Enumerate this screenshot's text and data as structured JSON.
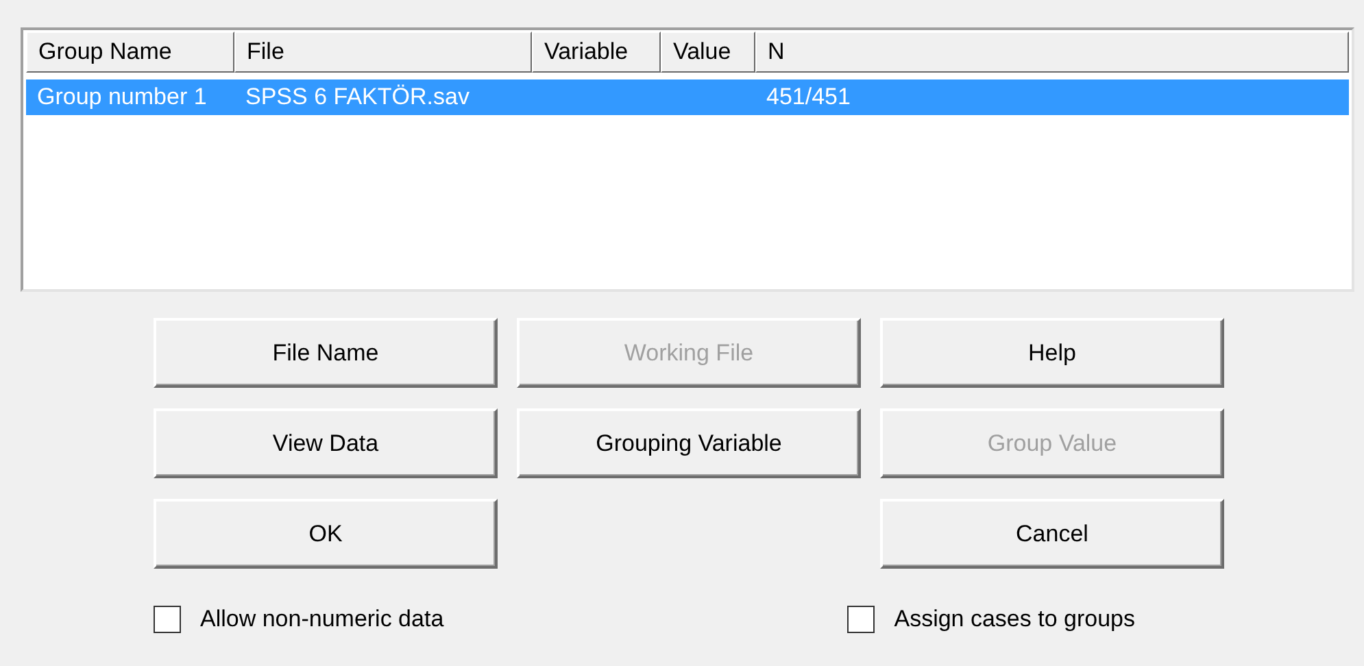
{
  "table": {
    "columns": [
      "Group Name",
      "File",
      "Variable",
      "Value",
      "N"
    ],
    "rows": [
      {
        "selected": true,
        "cells": [
          "Group number 1",
          "SPSS 6 FAKTÖR.sav",
          "",
          "",
          "451/451"
        ]
      }
    ]
  },
  "button_rows": [
    [
      {
        "label": "File Name",
        "disabled": false
      },
      {
        "label": "Working File",
        "disabled": true
      },
      {
        "label": "Help",
        "disabled": false
      }
    ],
    [
      {
        "label": "View Data",
        "disabled": false
      },
      {
        "label": "Grouping Variable",
        "disabled": false
      },
      {
        "label": "Group Value",
        "disabled": true
      }
    ],
    [
      {
        "label": "OK",
        "disabled": false
      },
      {
        "label": "Cancel",
        "disabled": false
      }
    ]
  ],
  "checkboxes": [
    {
      "label": "Allow non-numeric data",
      "checked": false
    },
    {
      "label": "Assign cases to groups",
      "checked": false
    }
  ]
}
